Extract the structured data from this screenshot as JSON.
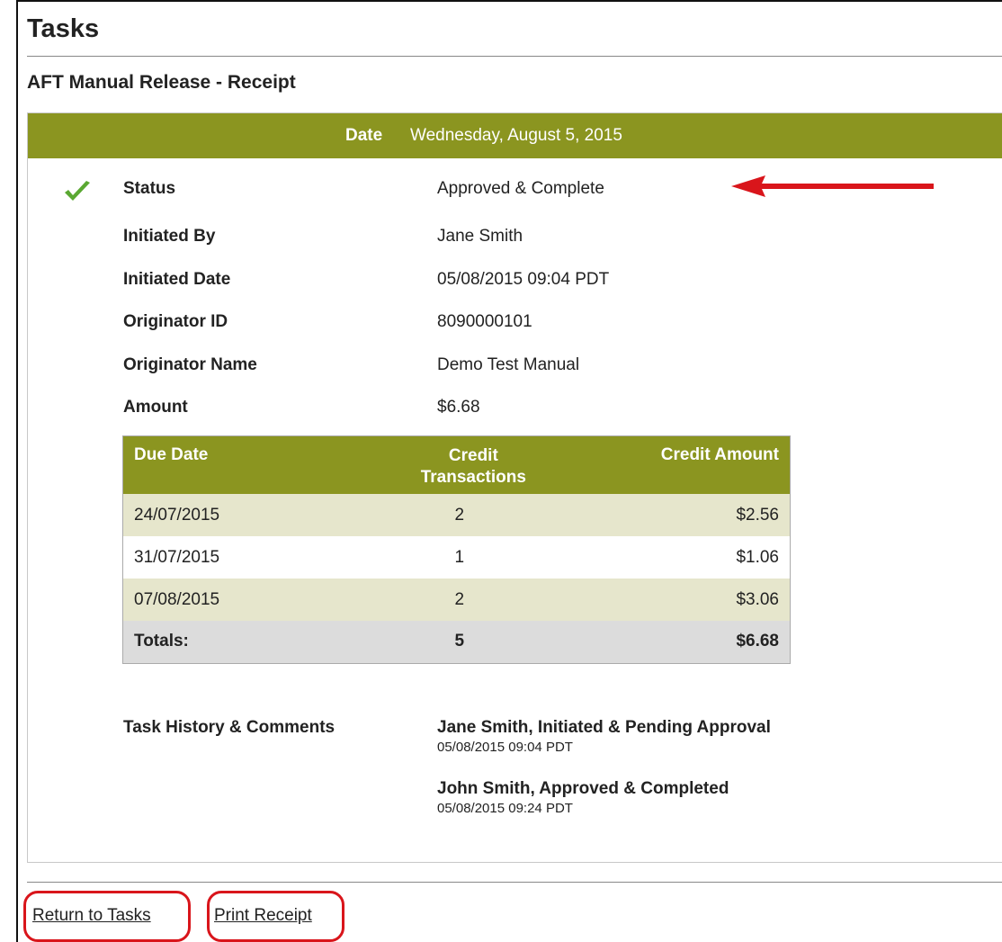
{
  "page": {
    "title": "Tasks",
    "subtitle": "AFT Manual Release - Receipt"
  },
  "date_bar": {
    "label": "Date",
    "value": "Wednesday, August 5, 2015"
  },
  "fields": [
    {
      "label": "Status",
      "value": "Approved & Complete"
    },
    {
      "label": "Initiated By",
      "value": "Jane Smith"
    },
    {
      "label": "Initiated Date",
      "value": "05/08/2015 09:04 PDT"
    },
    {
      "label": "Originator ID",
      "value": "8090000101"
    },
    {
      "label": "Originator Name",
      "value": "Demo Test Manual"
    },
    {
      "label": "Amount",
      "value": "$6.68"
    }
  ],
  "due_table": {
    "headers": {
      "due_date": "Due Date",
      "credit_transactions_1": "Credit",
      "credit_transactions_2": "Transactions",
      "credit_amount": "Credit Amount"
    },
    "rows": [
      {
        "due_date": "24/07/2015",
        "transactions": "2",
        "amount": "$2.56"
      },
      {
        "due_date": "31/07/2015",
        "transactions": "1",
        "amount": "$1.06"
      },
      {
        "due_date": "07/08/2015",
        "transactions": "2",
        "amount": "$3.06"
      }
    ],
    "totals": {
      "label": "Totals:",
      "transactions": "5",
      "amount": "$6.68"
    }
  },
  "history": {
    "label": "Task History & Comments",
    "entries": [
      {
        "title": "Jane Smith, Initiated & Pending Approval",
        "time": "05/08/2015 09:04 PDT"
      },
      {
        "title": "John Smith, Approved & Completed",
        "time": "05/08/2015 09:24 PDT"
      }
    ]
  },
  "actions": {
    "return_label": "Return to Tasks",
    "print_label": "Print Receipt"
  },
  "colors": {
    "header_bar": "#8b9520",
    "row_shade": "#e6e6cc",
    "totals_row": "#dcdcdc",
    "highlight": "#d9151b",
    "check": "#5aa832"
  },
  "icons": {
    "status": "checkmark-icon",
    "annotation": "red-arrow-icon"
  }
}
